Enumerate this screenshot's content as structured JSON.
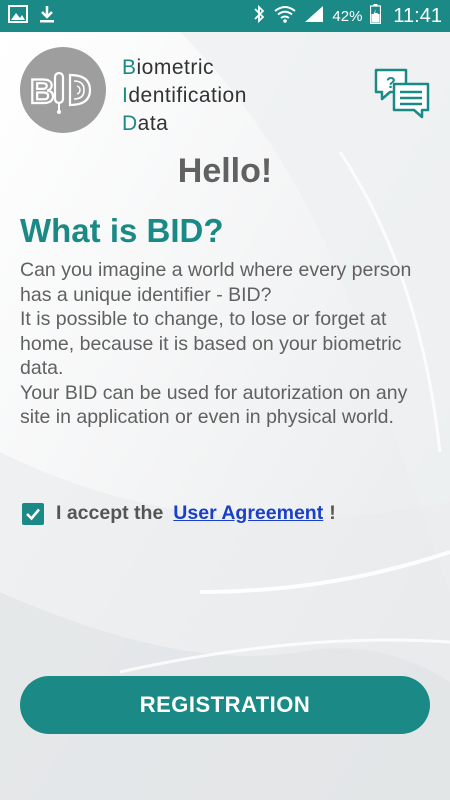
{
  "status_bar": {
    "battery_percent": "42%",
    "time": "11:41",
    "left_icons": [
      "gallery-icon",
      "download-icon"
    ],
    "right_icons": [
      "bluetooth-icon",
      "wifi-icon",
      "signal-icon",
      "battery-icon"
    ]
  },
  "logo": {
    "line1_first": "B",
    "line1_rest": "iometric",
    "line2_first": "I",
    "line2_rest": "dentification",
    "line3_first": "D",
    "line3_rest": "ata",
    "circle_text": "BID"
  },
  "hello": "Hello!",
  "heading": "What is BID?",
  "description": [
    "Can you imagine a world where every person has a unique identifier - BID?",
    "It is possible to change, to lose or forget at home, because it is based on your biometric data.",
    "Your BID can be used for autorization on any site in application or even in physical world."
  ],
  "agreement": {
    "checked": true,
    "prefix": "I accept the",
    "link": "User Agreement",
    "suffix": "!"
  },
  "register_button": "REGISTRATION",
  "colors": {
    "accent": "#1b8a87",
    "link": "#1a3fc8",
    "text": "#616161"
  }
}
